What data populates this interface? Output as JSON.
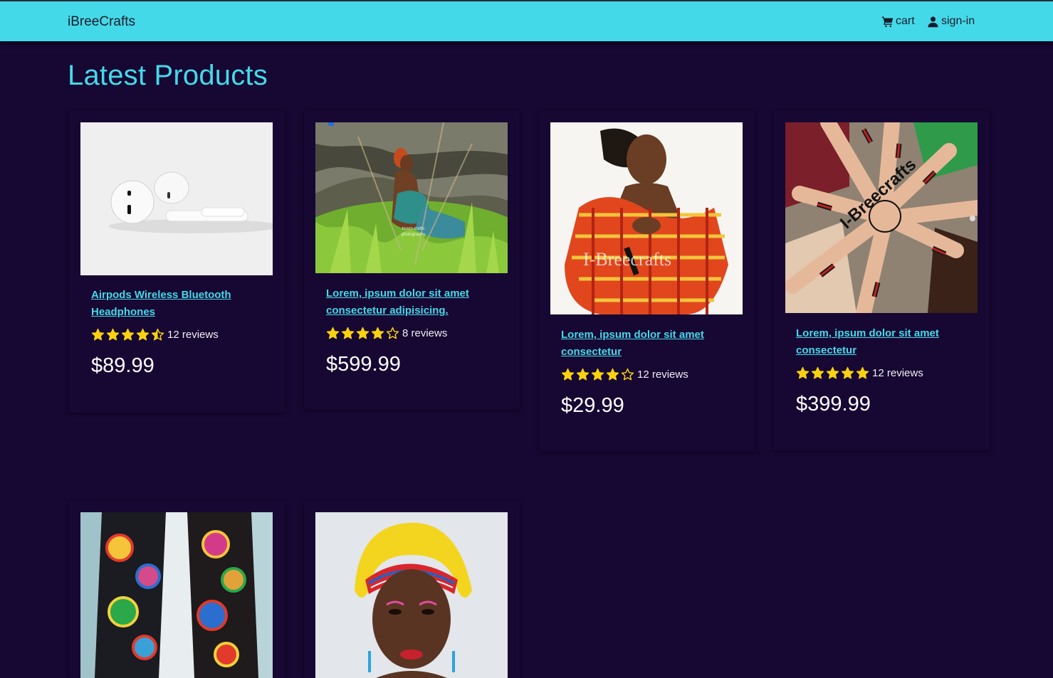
{
  "nav": {
    "brand": "iBreeCrafts",
    "cart_label": "cart",
    "signin_label": "sign-in"
  },
  "page_title": "Latest Products",
  "products": [
    {
      "title": "Airpods Wireless Bluetooth Headphones",
      "rating": 4.5,
      "reviews": "12 reviews",
      "price": "$89.99",
      "image": "airpods-photo"
    },
    {
      "title": "Lorem, ipsum dolor sit amet consectetur adipisicing.",
      "rating": 4,
      "reviews": "8 reviews",
      "price": "$599.99",
      "image": "woman-in-grass-photo",
      "image_caption": "lorem crafts photography"
    },
    {
      "title": "Lorem, ipsum dolor sit amet consectetur",
      "rating": 4,
      "reviews": "12 reviews",
      "price": "$29.99",
      "image": "woman-red-shuka-photo",
      "image_watermark": "I-Breecrafts"
    },
    {
      "title": "Lorem, ipsum dolor sit amet consectetur",
      "rating": 5,
      "reviews": "12 reviews",
      "price": "$399.99",
      "image": "hands-bracelets-photo",
      "image_watermark": "I-Breecrafts"
    },
    {
      "title": "",
      "image": "beaded-sandals-photo"
    },
    {
      "title": "",
      "image": "woman-yellow-headwrap-photo"
    }
  ],
  "colors": {
    "accent": "#44d9e8",
    "background": "#170733",
    "star": "#f8d20f"
  }
}
